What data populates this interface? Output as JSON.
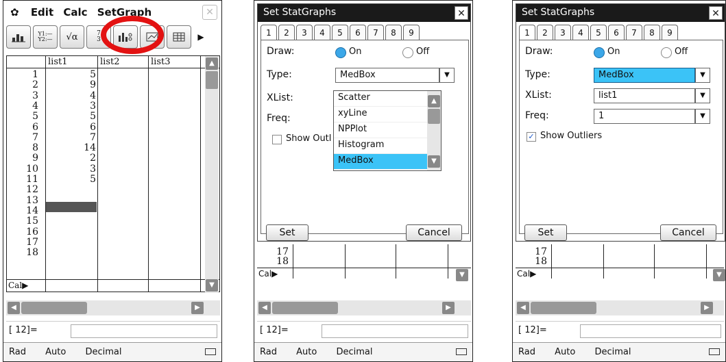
{
  "screen1": {
    "menu": [
      "Edit",
      "Calc",
      "SetGraph"
    ],
    "toolbar": [
      "Y1:—\nY2:—",
      "√α",
      "7\n3"
    ],
    "columns": [
      "list1",
      "list2",
      "list3"
    ],
    "row_numbers": [
      "1",
      "2",
      "3",
      "4",
      "5",
      "6",
      "7",
      "8",
      "9",
      "10",
      "11",
      "12",
      "13",
      "14",
      "15",
      "16",
      "17",
      "18"
    ],
    "list1": [
      "5",
      "9",
      "4",
      "3",
      "5",
      "6",
      "7",
      "14",
      "2",
      "3",
      "5"
    ],
    "cal_label": "Cal▶",
    "input_label": "[ 12]=",
    "status": [
      "Rad",
      "Auto",
      "Decimal"
    ]
  },
  "dialog_title": "Set StatGraphs",
  "tabs": [
    "1",
    "2",
    "3",
    "4",
    "5",
    "6",
    "7",
    "8",
    "9"
  ],
  "labels": {
    "draw": "Draw:",
    "type": "Type:",
    "xlist": "XList:",
    "freq": "Freq:",
    "on": "On",
    "off": "Off",
    "show_outliers": "Show Outliers",
    "show_outl_cut": "Show Outl",
    "set": "Set",
    "cancel": "Cancel"
  },
  "screen2": {
    "type_value": "MedBox",
    "dropdown_options": [
      "Scatter",
      "xyLine",
      "NPPlot",
      "Histogram",
      "MedBox"
    ],
    "selected_option": "MedBox"
  },
  "screen3": {
    "type_value": "MedBox",
    "xlist_value": "list1",
    "freq_value": "1",
    "show_outliers_checked": true
  },
  "below": {
    "rows": [
      "17",
      "18"
    ],
    "cal": "Cal▶",
    "input": "[ 12]="
  },
  "status": [
    "Rad",
    "Auto",
    "Decimal"
  ],
  "colors": {
    "highlight": "#3bc3f7",
    "radio_on": "#3ba7e8",
    "title_bar": "#1a1a1a",
    "annotation": "#e31212"
  }
}
